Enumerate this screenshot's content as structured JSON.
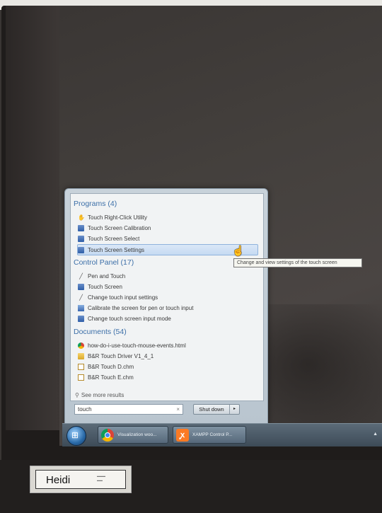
{
  "start_menu": {
    "programs": {
      "header": "Programs (4)",
      "items": [
        {
          "label": "Touch Right-Click Utility",
          "icon": "hand-icon"
        },
        {
          "label": "Touch Screen Calibration",
          "icon": "screen-icon"
        },
        {
          "label": "Touch Screen Select",
          "icon": "screen-icon"
        },
        {
          "label": "Touch Screen Settings",
          "icon": "screen-icon",
          "selected": true
        }
      ]
    },
    "control_panel": {
      "header": "Control Panel (17)",
      "items": [
        {
          "label": "Pen and Touch",
          "icon": "pen-icon"
        },
        {
          "label": "Touch Screen",
          "icon": "screen-icon"
        },
        {
          "label": "Change touch input settings",
          "icon": "pen-icon"
        },
        {
          "label": "Calibrate the screen for pen or touch input",
          "icon": "calibrate-icon"
        },
        {
          "label": "Change touch screen input mode",
          "icon": "screen-icon"
        }
      ]
    },
    "documents": {
      "header": "Documents (54)",
      "items": [
        {
          "label": "how-do-i-use-touch-mouse-events.html",
          "icon": "chrome-icon"
        },
        {
          "label": "B&R Touch Driver V1_4_1",
          "icon": "folder-icon"
        },
        {
          "label": "B&R Touch D.chm",
          "icon": "chm-file-icon"
        },
        {
          "label": "B&R Touch E.chm",
          "icon": "chm-file-icon"
        }
      ]
    },
    "see_more": "See more results",
    "search": {
      "value": "touch",
      "clear": "×"
    },
    "shutdown": {
      "label": "Shut down",
      "arrow": "▸"
    }
  },
  "tooltip": "Change and view settings of the touch screen",
  "taskbar": {
    "items": [
      {
        "label": "Visualization woo...",
        "icon": "chrome-icon"
      },
      {
        "label": "XAMPP Control P...",
        "icon": "xampp-icon"
      }
    ],
    "tray_arrow": "▲"
  },
  "name_label": {
    "name": "Heidi"
  }
}
